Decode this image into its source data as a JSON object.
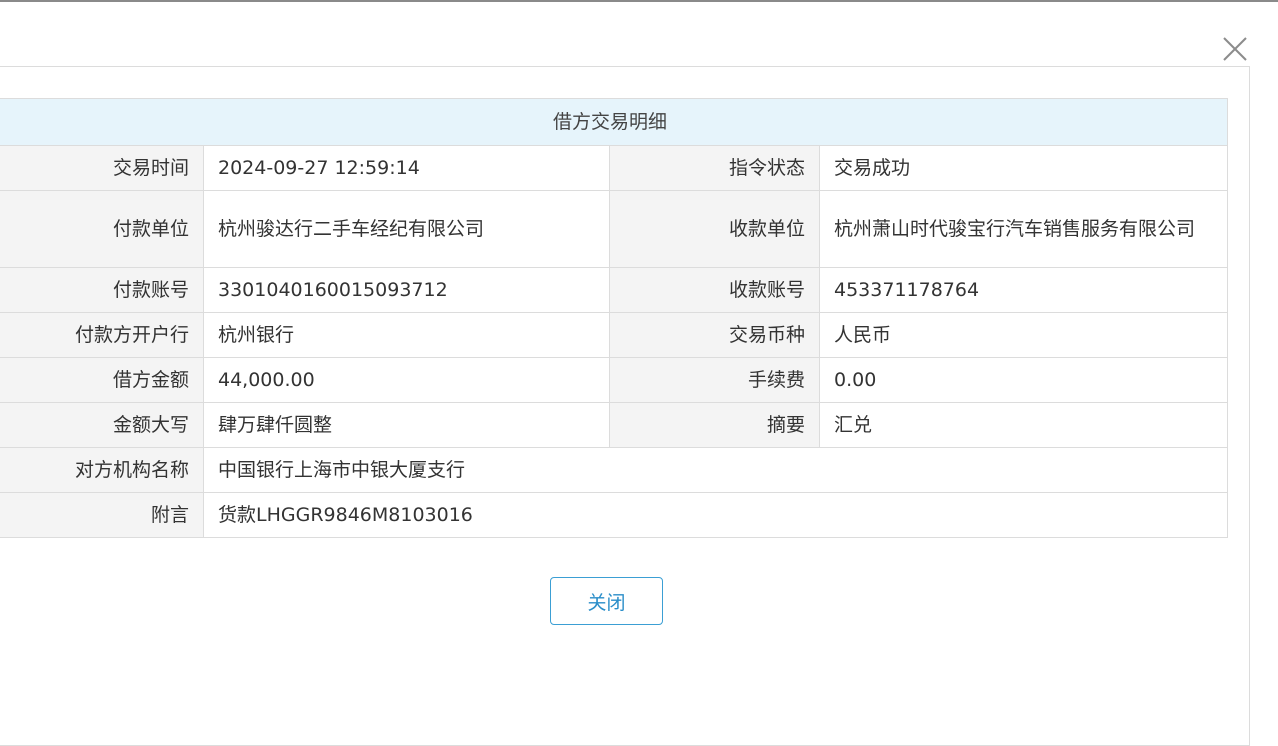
{
  "dialog": {
    "table_title": "借方交易明细",
    "rows": [
      {
        "label1": "交易时间",
        "value1": "2024-09-27 12:59:14",
        "label2": "指令状态",
        "value2": "交易成功"
      },
      {
        "label1": "付款单位",
        "value1": "杭州骏达行二手车经纪有限公司",
        "label2": "收款单位",
        "value2": "杭州萧山时代骏宝行汽车销售服务有限公司"
      },
      {
        "label1": "付款账号",
        "value1": "3301040160015093712",
        "label2": "收款账号",
        "value2": "453371178764"
      },
      {
        "label1": "付款方开户行",
        "value1": "杭州银行",
        "label2": "交易币种",
        "value2": "人民币"
      },
      {
        "label1": "借方金额",
        "value1": "44,000.00",
        "label2": "手续费",
        "value2": "0.00"
      },
      {
        "label1": "金额大写",
        "value1": "肆万肆仟圆整",
        "label2": "摘要",
        "value2": "汇兑"
      },
      {
        "label1": "对方机构名称",
        "value1": "中国银行上海市中银大厦支行"
      },
      {
        "label1": "附言",
        "value1": "货款LHGGR9846M8103016"
      }
    ],
    "close_button_label": "关闭",
    "close_icon": "close-icon"
  },
  "colors": {
    "header_bg": "#e6f4fb",
    "label_bg": "#f4f4f4",
    "border": "#dcdcdc",
    "button_accent": "#2a8ec9"
  }
}
